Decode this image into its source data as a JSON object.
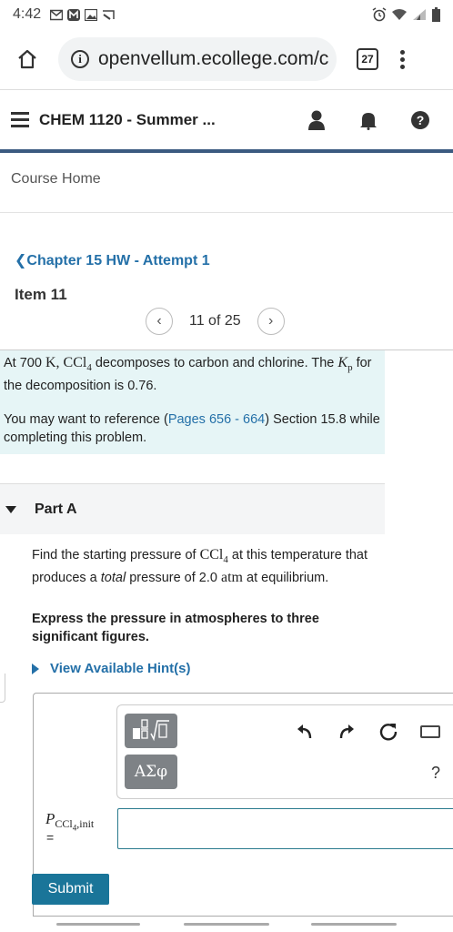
{
  "status_bar": {
    "time": "4:42",
    "icons": [
      "gmail-icon",
      "app-notification-icon",
      "image-icon",
      "cast-icon",
      "alarm-icon",
      "wifi-icon",
      "signal-icon",
      "battery-icon"
    ]
  },
  "browser": {
    "url": "openvellum.ecollege.com/c",
    "tab_count": "27"
  },
  "app_header": {
    "course_title": "CHEM 1120 - Summer ..."
  },
  "course_home": "Course Home",
  "assignment": {
    "chapter_link": "Chapter 15 HW - Attempt 1",
    "item_title": "Item 11",
    "pager_text": "11 of 25"
  },
  "intro": {
    "s1_a": "At 700 ",
    "s1_temp": "K",
    "s1_b": ", ",
    "s1_formula": "CCl",
    "s1_formula_sub": "4",
    "s1_c": " decomposes to carbon and chlorine. The ",
    "s1_kp": "K",
    "s1_kp_sub": "p",
    "s1_d": " for the decomposition is 0.76.",
    "s2_a": "You may want to reference (",
    "s2_link": "Pages 656 - 664",
    "s2_b": ") Section 15.8 while completing this problem."
  },
  "part": {
    "label": "Part A",
    "q_a": "Find the starting pressure of ",
    "q_formula": "CCl",
    "q_formula_sub": "4",
    "q_b": " at this temperature that produces a ",
    "q_total": "total",
    "q_c": " pressure of 2.0 ",
    "q_unit": "atm",
    "q_d": " at equilibrium.",
    "instruction": "Express the pressure in atmospheres to three significant figures.",
    "hint_link": "View Available Hint(s)"
  },
  "answer": {
    "symbol_button": "ΑΣφ",
    "help_label": "?",
    "label_p": "P",
    "label_sub": "CCl",
    "label_sub2": "4",
    "label_sub3": ",init",
    "equals": "=",
    "value": "",
    "submit_label": "Submit"
  }
}
